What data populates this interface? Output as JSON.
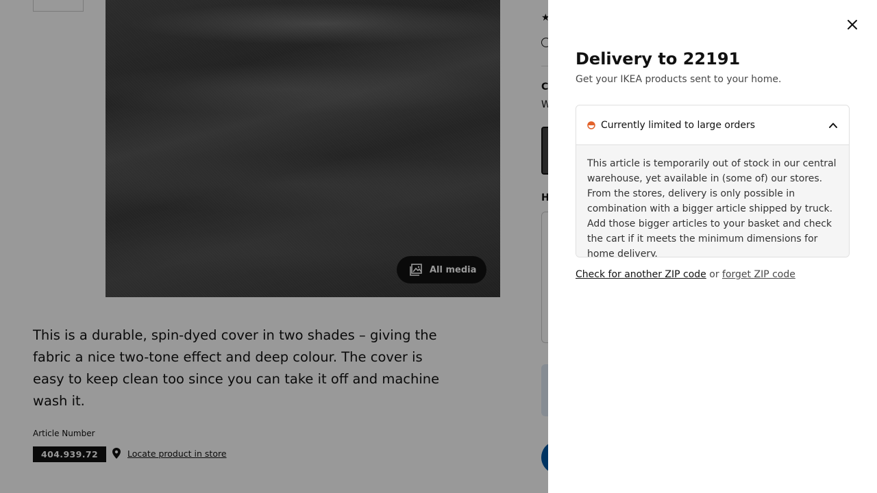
{
  "product": {
    "media_button_label": "All media",
    "description": "This is a durable, spin-dyed cover in two shades – giving the fabric a nice two-tone effect and deep colour. The cover is easy to keep clean too since you can take it off and machine wash it.",
    "article_label": "Article Number",
    "article_number": "404.939.72",
    "locate_link": "Locate product in store"
  },
  "right_column": {
    "section_letter_c": "C",
    "section_letter_w": "W",
    "section_letter_h": "H"
  },
  "drawer": {
    "title": "Delivery to 22191",
    "subtitle": "Get your IKEA products sent to your home.",
    "status": {
      "label": "Currently limited to large orders",
      "color": "#e2622b",
      "expanded": true,
      "body": "This article is temporarily out of stock in our central warehouse, yet available in (some of) our stores. From the stores, delivery is only possible in combination with a bigger article shipped by truck. Add those bigger articles to your basket and check the cart if it meets the minimum dimensions for home delivery."
    },
    "zip": {
      "check_link": "Check for another ZIP code",
      "connector": "or",
      "forget_link": "forget ZIP code"
    }
  },
  "colors": {
    "overlay": "rgba(0,0,0,0.40)",
    "accent_blue": "#0058a3",
    "status_orange": "#e2622b"
  },
  "icons": [
    "all-media-icon",
    "location-pin-icon",
    "close-icon",
    "half-circle-status-icon",
    "chevron-up-icon",
    "star-icon",
    "info-icon"
  ]
}
